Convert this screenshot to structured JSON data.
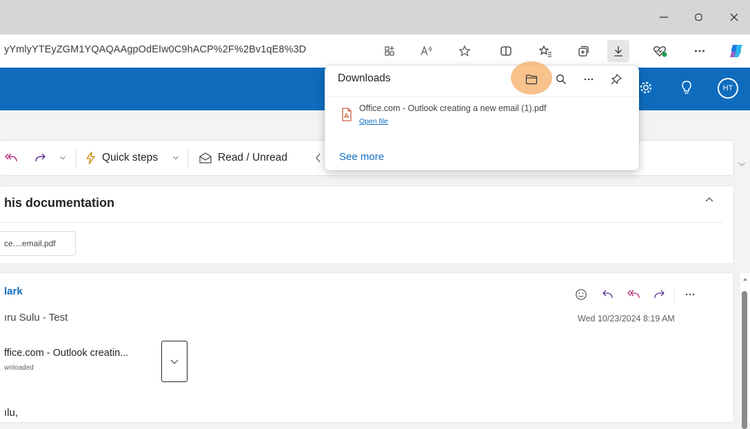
{
  "browser": {
    "url": "yYmlyYTEyZGM1YQAQAAgpOdEIw0C9hACP%2F%2Bv1qE8%3D",
    "window_buttons": {
      "minimize": "–",
      "maximize": "▢",
      "close": "✕"
    }
  },
  "outlook": {
    "avatar_initials": "HT",
    "command_bar": {
      "quick_steps_label": "Quick steps",
      "read_unread_label": "Read / Unread"
    },
    "subject": "his documentation",
    "subject_attachment": "ce....email.pdf",
    "message": {
      "sender": "lark",
      "to": "ıru Sulu - Test",
      "time": "Wed 10/23/2024 8:19 AM",
      "attachment_name": "ffice.com - Outlook creatin...",
      "attachment_status": "wnloaded",
      "greeting": "ılu,"
    }
  },
  "downloads": {
    "title": "Downloads",
    "items": [
      {
        "name": "Office.com - Outlook creating a new email (1).pdf",
        "action": "Open file"
      }
    ],
    "see_more": "See more"
  },
  "colors": {
    "outlook_blue": "#0f6cbd",
    "highlight": "#f5aa5f",
    "pdf_red": "#c43e1c"
  }
}
